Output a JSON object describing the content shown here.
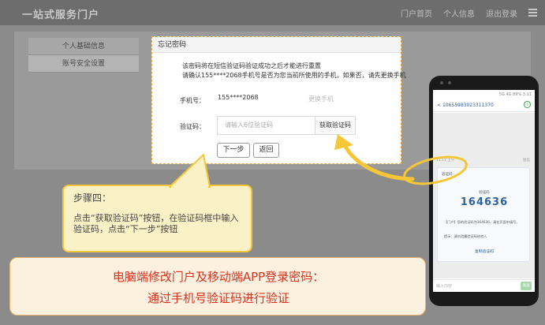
{
  "app": {
    "logo": "一站式服务门户",
    "nav": [
      "门户首页",
      "个人信息",
      "退出登录"
    ]
  },
  "sidebar": {
    "items": [
      "个人基础信息",
      "账号安全设置"
    ]
  },
  "dialog": {
    "title": "忘记密码",
    "line1": "该密码将在短信验证码验证成功之后才能进行重置",
    "line2": "请确认155****2068手机号是否为您当前所使用的手机，如果否，请先更换手机",
    "phone_label": "手机号：",
    "phone_value": "155****2068",
    "change_phone": "更换手机",
    "code_label": "验证码：",
    "code_placeholder": "请输入6位验证码",
    "get_code_button": "获取验证码",
    "next_button": "下一步",
    "back_button": "返回"
  },
  "callout": {
    "title": "步骤四：",
    "text": "点击“获取验证码”按钮，在验证码框中输入验证码，点击“下一步”按钮"
  },
  "banner": {
    "line1": "电脑端修改门户及移动端APP登录密码：",
    "line2": "通过手机号验证码进行验证"
  },
  "phone": {
    "status": "5G 4G 89% 3:11",
    "sender": "10655983023311370",
    "msg_time": "11:11 上午",
    "msg_right": "短信",
    "sms_head": "验证码",
    "sms_label": "验证码",
    "sms_code": "164636",
    "sms_body": "【门户】您的验证码为164636，请在页面中填写。",
    "sms_tip": "提示：请勿泄露验证码给他人",
    "sms_copy": "复制验证码",
    "input_placeholder": "输入内容",
    "send_label": "发送"
  },
  "colors": {
    "accent": "#f5c637",
    "banner_text": "#d9321f",
    "code_blue": "#2a63a8"
  }
}
